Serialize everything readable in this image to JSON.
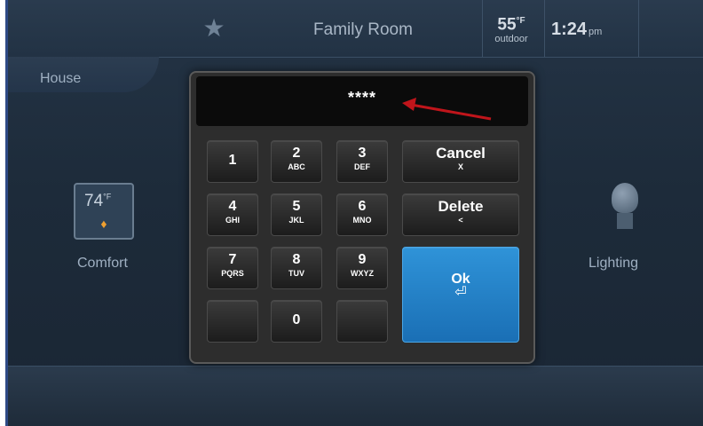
{
  "header": {
    "favorite_icon": "star-icon",
    "room": "Family Room",
    "temperature": "55",
    "temperature_unit": "°F",
    "temperature_label": "outdoor",
    "time": "1:24",
    "ampm": "pm"
  },
  "nav": {
    "house": "House"
  },
  "tiles": {
    "comfort": {
      "label": "Comfort",
      "reading": "74",
      "unit": "°F",
      "icon": "thermostat-icon"
    },
    "lighting": {
      "label": "Lighting",
      "icon": "lightbulb-icon"
    }
  },
  "keypad": {
    "display": "****",
    "keys": [
      {
        "main": "1",
        "sub": ""
      },
      {
        "main": "2",
        "sub": "ABC"
      },
      {
        "main": "3",
        "sub": "DEF"
      },
      {
        "main": "4",
        "sub": "GHI"
      },
      {
        "main": "5",
        "sub": "JKL"
      },
      {
        "main": "6",
        "sub": "MNO"
      },
      {
        "main": "7",
        "sub": "PQRS"
      },
      {
        "main": "8",
        "sub": "TUV"
      },
      {
        "main": "9",
        "sub": "WXYZ"
      },
      {
        "main": "",
        "sub": ""
      },
      {
        "main": "0",
        "sub": ""
      },
      {
        "main": "",
        "sub": ""
      }
    ],
    "cancel": {
      "label": "Cancel",
      "sub": "X"
    },
    "delete": {
      "label": "Delete",
      "sub": "<"
    },
    "ok": {
      "label": "Ok",
      "icon": "enter-icon"
    },
    "annotation_color": "#c0151b"
  }
}
